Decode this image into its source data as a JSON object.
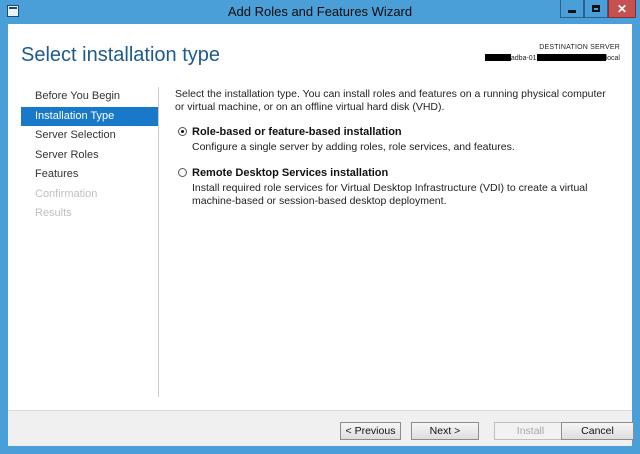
{
  "window": {
    "title": "Add Roles and Features Wizard"
  },
  "header": {
    "page_title": "Select installation type",
    "destination_label": "DESTINATION SERVER",
    "server_middle": "adba-01",
    "server_suffix": "local"
  },
  "nav": {
    "items": [
      {
        "label": "Before You Begin",
        "state": "normal"
      },
      {
        "label": "Installation Type",
        "state": "active"
      },
      {
        "label": "Server Selection",
        "state": "normal"
      },
      {
        "label": "Server Roles",
        "state": "normal"
      },
      {
        "label": "Features",
        "state": "normal"
      },
      {
        "label": "Confirmation",
        "state": "disabled"
      },
      {
        "label": "Results",
        "state": "disabled"
      }
    ]
  },
  "main": {
    "description": "Select the installation type. You can install roles and features on a running physical computer or virtual machine, or on an offline virtual hard disk (VHD).",
    "options": [
      {
        "label": "Role-based or feature-based installation",
        "description": "Configure a single server by adding roles, role services, and features.",
        "selected": true
      },
      {
        "label": "Remote Desktop Services installation",
        "description": "Install required role services for Virtual Desktop Infrastructure (VDI) to create a virtual machine-based or session-based desktop deployment.",
        "selected": false
      }
    ]
  },
  "footer": {
    "previous_label": "< Previous",
    "next_label": "Next >",
    "install_label": "Install",
    "cancel_label": "Cancel"
  },
  "colors": {
    "titlebar": "#4b9fd8",
    "accent": "#1979c9",
    "title_text": "#1e5a8c",
    "close_button": "#c75050"
  },
  "icons": [
    "app-icon",
    "minimize-icon",
    "maximize-icon",
    "close-icon"
  ]
}
